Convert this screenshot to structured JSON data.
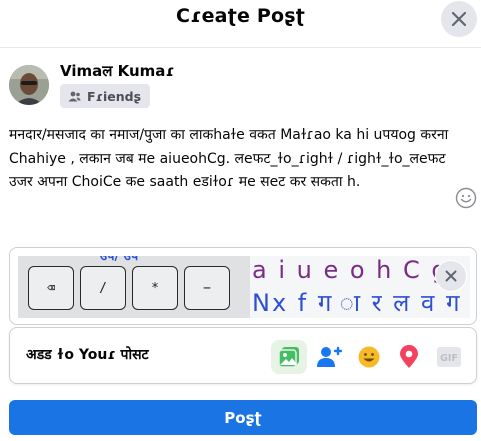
{
  "dialog": {
    "title": "Cɾeaʈe Poʂʈ"
  },
  "author": {
    "name": "Vimaल Kumaɾ",
    "audience": "Fɾiendʂ"
  },
  "post": {
    "text": "मनदार/मसजाद का नमाज/पुजा का लाकhaɫe वकत Maɫɾao ka hi uपयog करना Chahiye , लकान जब मe aiueohCg. लeफट_ɫo_ɾighɫ / ɾighɫ_ɫo_लeफट उजर अपना ChoiCe कe saath eडiɫoɾ मe सeट कर सकता h."
  },
  "attachment": {
    "keyboard_top_text": "उप/ उप",
    "keys": [
      "⌫",
      "/",
      "*",
      "−"
    ],
    "row1_text": "a i u e o h C g",
    "row2_text": "Nx f ग ा र ल व ग"
  },
  "add_to_post": {
    "label": "अडड ɫo Youɾ पोसट",
    "icons": [
      "photo-icon",
      "tag-people-icon",
      "feeling-icon",
      "check-in-icon",
      "gif-icon"
    ],
    "gif_label": "GIF"
  },
  "actions": {
    "post_label": "Poʂʈ"
  },
  "colors": {
    "primary": "#1b74e4",
    "photo_green": "#45bd62",
    "tag_blue": "#1877f2",
    "feeling_yellow": "#f7b928",
    "checkin_red": "#f3425f",
    "gray_bg": "#e4e6eb"
  }
}
